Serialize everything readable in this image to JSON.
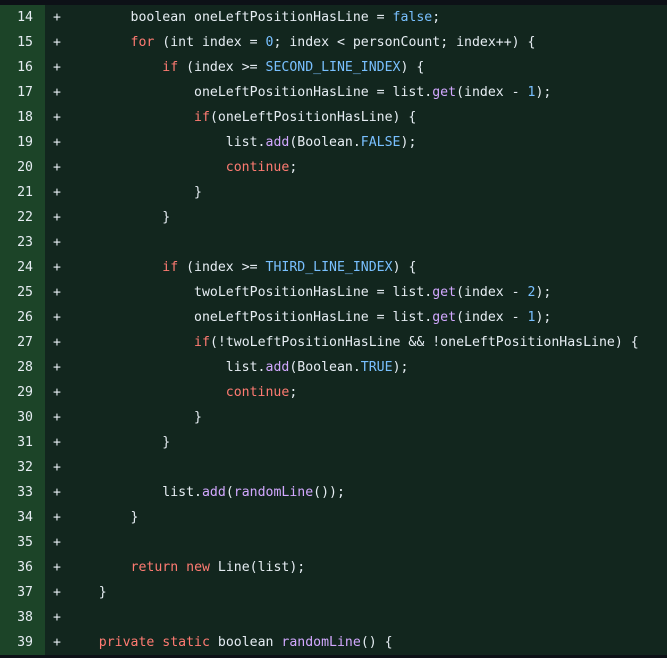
{
  "colors": {
    "line_number_bg": "#1c4428",
    "code_bg": "#12261e",
    "text": "#e6edf3",
    "keyword": "#ff7b72",
    "constant": "#79c0ff",
    "function": "#d2a8ff"
  },
  "diff": {
    "lines": [
      {
        "number": "14",
        "marker": "+",
        "indent": "        ",
        "tokens": [
          {
            "t": "boolean oneLeftPositionHasLine = ",
            "k": "plain"
          },
          {
            "t": "false",
            "k": "constant"
          },
          {
            "t": ";",
            "k": "plain"
          }
        ]
      },
      {
        "number": "15",
        "marker": "+",
        "indent": "        ",
        "tokens": [
          {
            "t": "for",
            "k": "keyword"
          },
          {
            "t": " (int index = ",
            "k": "plain"
          },
          {
            "t": "0",
            "k": "constant"
          },
          {
            "t": "; index < personCount; index++) {",
            "k": "plain"
          }
        ]
      },
      {
        "number": "16",
        "marker": "+",
        "indent": "            ",
        "tokens": [
          {
            "t": "if",
            "k": "keyword"
          },
          {
            "t": " (index >= ",
            "k": "plain"
          },
          {
            "t": "SECOND_LINE_INDEX",
            "k": "constant"
          },
          {
            "t": ") {",
            "k": "plain"
          }
        ]
      },
      {
        "number": "17",
        "marker": "+",
        "indent": "                ",
        "tokens": [
          {
            "t": "oneLeftPositionHasLine = list.",
            "k": "plain"
          },
          {
            "t": "get",
            "k": "function"
          },
          {
            "t": "(index - ",
            "k": "plain"
          },
          {
            "t": "1",
            "k": "constant"
          },
          {
            "t": ");",
            "k": "plain"
          }
        ]
      },
      {
        "number": "18",
        "marker": "+",
        "indent": "                ",
        "tokens": [
          {
            "t": "if",
            "k": "keyword"
          },
          {
            "t": "(oneLeftPositionHasLine) {",
            "k": "plain"
          }
        ]
      },
      {
        "number": "19",
        "marker": "+",
        "indent": "                    ",
        "tokens": [
          {
            "t": "list.",
            "k": "plain"
          },
          {
            "t": "add",
            "k": "function"
          },
          {
            "t": "(Boolean.",
            "k": "plain"
          },
          {
            "t": "FALSE",
            "k": "constant"
          },
          {
            "t": ");",
            "k": "plain"
          }
        ]
      },
      {
        "number": "20",
        "marker": "+",
        "indent": "                    ",
        "tokens": [
          {
            "t": "continue",
            "k": "keyword"
          },
          {
            "t": ";",
            "k": "plain"
          }
        ]
      },
      {
        "number": "21",
        "marker": "+",
        "indent": "                ",
        "tokens": [
          {
            "t": "}",
            "k": "plain"
          }
        ]
      },
      {
        "number": "22",
        "marker": "+",
        "indent": "            ",
        "tokens": [
          {
            "t": "}",
            "k": "plain"
          }
        ]
      },
      {
        "number": "23",
        "marker": "+",
        "indent": "",
        "tokens": []
      },
      {
        "number": "24",
        "marker": "+",
        "indent": "            ",
        "tokens": [
          {
            "t": "if",
            "k": "keyword"
          },
          {
            "t": " (index >= ",
            "k": "plain"
          },
          {
            "t": "THIRD_LINE_INDEX",
            "k": "constant"
          },
          {
            "t": ") {",
            "k": "plain"
          }
        ]
      },
      {
        "number": "25",
        "marker": "+",
        "indent": "                ",
        "tokens": [
          {
            "t": "twoLeftPositionHasLine = list.",
            "k": "plain"
          },
          {
            "t": "get",
            "k": "function"
          },
          {
            "t": "(index - ",
            "k": "plain"
          },
          {
            "t": "2",
            "k": "constant"
          },
          {
            "t": ");",
            "k": "plain"
          }
        ]
      },
      {
        "number": "26",
        "marker": "+",
        "indent": "                ",
        "tokens": [
          {
            "t": "oneLeftPositionHasLine = list.",
            "k": "plain"
          },
          {
            "t": "get",
            "k": "function"
          },
          {
            "t": "(index - ",
            "k": "plain"
          },
          {
            "t": "1",
            "k": "constant"
          },
          {
            "t": ");",
            "k": "plain"
          }
        ]
      },
      {
        "number": "27",
        "marker": "+",
        "indent": "                ",
        "tokens": [
          {
            "t": "if",
            "k": "keyword"
          },
          {
            "t": "(!twoLeftPositionHasLine && !oneLeftPositionHasLine) {",
            "k": "plain"
          }
        ]
      },
      {
        "number": "28",
        "marker": "+",
        "indent": "                    ",
        "tokens": [
          {
            "t": "list.",
            "k": "plain"
          },
          {
            "t": "add",
            "k": "function"
          },
          {
            "t": "(Boolean.",
            "k": "plain"
          },
          {
            "t": "TRUE",
            "k": "constant"
          },
          {
            "t": ");",
            "k": "plain"
          }
        ]
      },
      {
        "number": "29",
        "marker": "+",
        "indent": "                    ",
        "tokens": [
          {
            "t": "continue",
            "k": "keyword"
          },
          {
            "t": ";",
            "k": "plain"
          }
        ]
      },
      {
        "number": "30",
        "marker": "+",
        "indent": "                ",
        "tokens": [
          {
            "t": "}",
            "k": "plain"
          }
        ]
      },
      {
        "number": "31",
        "marker": "+",
        "indent": "            ",
        "tokens": [
          {
            "t": "}",
            "k": "plain"
          }
        ]
      },
      {
        "number": "32",
        "marker": "+",
        "indent": "",
        "tokens": []
      },
      {
        "number": "33",
        "marker": "+",
        "indent": "            ",
        "tokens": [
          {
            "t": "list.",
            "k": "plain"
          },
          {
            "t": "add",
            "k": "function"
          },
          {
            "t": "(",
            "k": "plain"
          },
          {
            "t": "randomLine",
            "k": "function"
          },
          {
            "t": "());",
            "k": "plain"
          }
        ]
      },
      {
        "number": "34",
        "marker": "+",
        "indent": "        ",
        "tokens": [
          {
            "t": "}",
            "k": "plain"
          }
        ]
      },
      {
        "number": "35",
        "marker": "+",
        "indent": "",
        "tokens": []
      },
      {
        "number": "36",
        "marker": "+",
        "indent": "        ",
        "tokens": [
          {
            "t": "return",
            "k": "keyword"
          },
          {
            "t": " ",
            "k": "plain"
          },
          {
            "t": "new",
            "k": "keyword"
          },
          {
            "t": " Line(list);",
            "k": "plain"
          }
        ]
      },
      {
        "number": "37",
        "marker": "+",
        "indent": "    ",
        "tokens": [
          {
            "t": "}",
            "k": "plain"
          }
        ]
      },
      {
        "number": "38",
        "marker": "+",
        "indent": "",
        "tokens": []
      },
      {
        "number": "39",
        "marker": "+",
        "indent": "    ",
        "tokens": [
          {
            "t": "private",
            "k": "keyword"
          },
          {
            "t": " ",
            "k": "plain"
          },
          {
            "t": "static",
            "k": "keyword"
          },
          {
            "t": " boolean ",
            "k": "plain"
          },
          {
            "t": "randomLine",
            "k": "function"
          },
          {
            "t": "() {",
            "k": "plain"
          }
        ]
      }
    ]
  }
}
